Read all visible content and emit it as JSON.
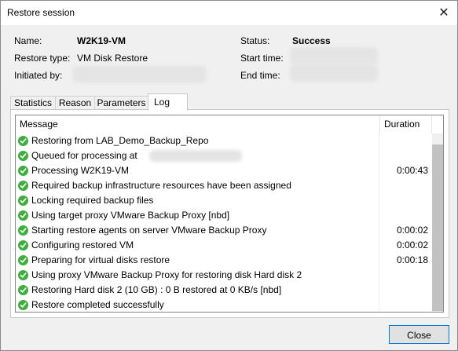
{
  "window": {
    "title": "Restore session",
    "close_glyph": "✕"
  },
  "info": {
    "name_label": "Name:",
    "name_value": "W2K19-VM",
    "restore_type_label": "Restore type:",
    "restore_type_value": "VM Disk Restore",
    "initiated_by_label": "Initiated by:",
    "status_label": "Status:",
    "status_value": "Success",
    "start_time_label": "Start time:",
    "end_time_label": "End time:"
  },
  "tabs": [
    {
      "label": "Statistics"
    },
    {
      "label": "Reason"
    },
    {
      "label": "Parameters"
    },
    {
      "label": "Log",
      "active": true
    }
  ],
  "log": {
    "headers": {
      "message": "Message",
      "duration": "Duration"
    },
    "status_icon": "success-check-icon",
    "status_color": "#3fae3f",
    "rows": [
      {
        "message": "Restoring from LAB_Demo_Backup_Repo",
        "duration": ""
      },
      {
        "message": "Queued for processing at",
        "duration": ""
      },
      {
        "message": "Processing W2K19-VM",
        "duration": "0:00:43"
      },
      {
        "message": "Required backup infrastructure resources have been assigned",
        "duration": ""
      },
      {
        "message": "Locking required backup files",
        "duration": ""
      },
      {
        "message": "Using target proxy VMware Backup Proxy [nbd]",
        "duration": ""
      },
      {
        "message": "Starting restore agents on server VMware Backup Proxy",
        "duration": "0:00:02"
      },
      {
        "message": "Configuring restored VM",
        "duration": "0:00:02"
      },
      {
        "message": "Preparing for virtual disks restore",
        "duration": "0:00:18"
      },
      {
        "message": "Using proxy VMware Backup Proxy for restoring disk Hard disk 2",
        "duration": ""
      },
      {
        "message": "Restoring Hard disk 2 (10 GB) : 0 B restored at 0 KB/s  [nbd]",
        "duration": ""
      },
      {
        "message": "Restore completed successfully",
        "duration": ""
      }
    ]
  },
  "footer": {
    "close_label": "Close"
  },
  "colors": {
    "accent": "#0078d7",
    "success": "#3fae3f"
  }
}
